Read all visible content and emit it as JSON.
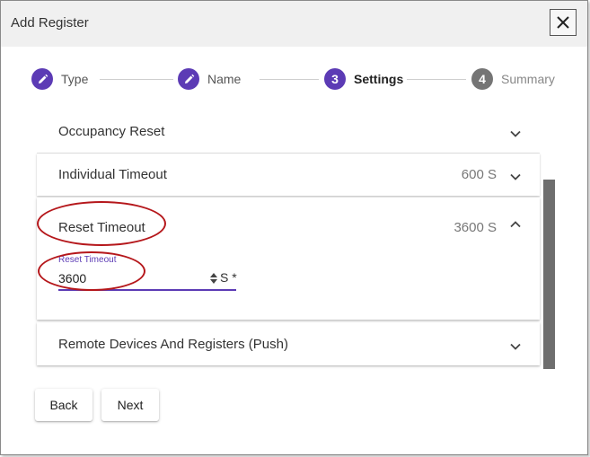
{
  "dialog": {
    "title": "Add Register",
    "close_icon": "close-icon"
  },
  "stepper": {
    "accent": "#5c3bb5",
    "inactive_color": "#757575",
    "steps": [
      {
        "number": "",
        "icon": "pencil-icon",
        "label": "Type",
        "state": "done"
      },
      {
        "number": "",
        "icon": "pencil-icon",
        "label": "Name",
        "state": "done"
      },
      {
        "number": "3",
        "icon": "",
        "label": "Settings",
        "state": "active"
      },
      {
        "number": "4",
        "icon": "",
        "label": "Summary",
        "state": "inactive"
      }
    ]
  },
  "panels": {
    "occupancy_reset": {
      "title": "Occupancy Reset",
      "value": "",
      "icon": "chevron-down-icon"
    },
    "individual_timeout": {
      "title": "Individual Timeout",
      "value": "600 S",
      "icon": "chevron-down-icon"
    },
    "reset_timeout": {
      "title": "Reset Timeout",
      "value": "3600 S",
      "icon": "chevron-up-icon",
      "field": {
        "label": "Reset Timeout",
        "value": "3600",
        "unit": "S *",
        "spinner_icon": "spinner-arrows-icon"
      }
    },
    "remote_devices": {
      "title": "Remote Devices And Registers (Push)",
      "value": "",
      "icon": "chevron-down-icon"
    }
  },
  "footer": {
    "back_label": "Back",
    "next_label": "Next"
  },
  "colors": {
    "annotation": "#b5171b",
    "scrollbar": "#6e6e6e"
  }
}
